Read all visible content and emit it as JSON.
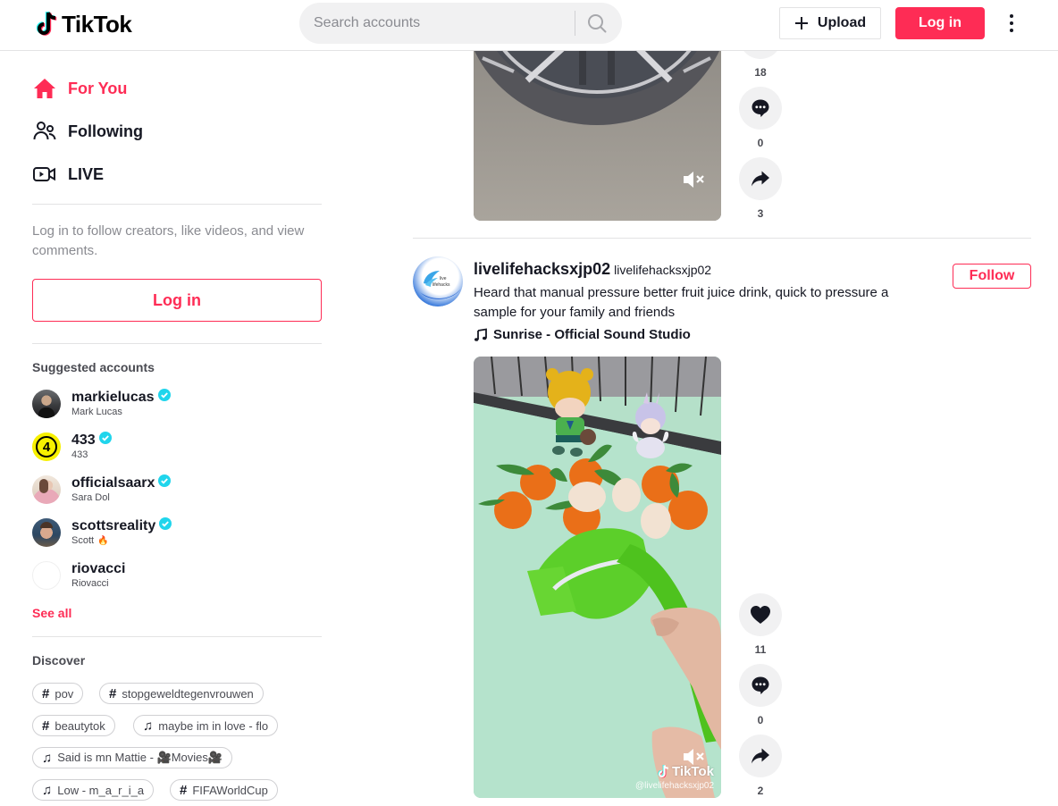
{
  "header": {
    "logo_text": "TikTok",
    "search_placeholder": "Search accounts",
    "upload_label": "Upload",
    "login_label": "Log in"
  },
  "sidebar": {
    "nav": [
      {
        "label": "For You",
        "icon": "home-icon",
        "active": true
      },
      {
        "label": "Following",
        "icon": "people-icon",
        "active": false
      },
      {
        "label": "LIVE",
        "icon": "live-camera-icon",
        "active": false
      }
    ],
    "login_hint": "Log in to follow creators, like videos, and view comments.",
    "login_label": "Log in",
    "suggested_title": "Suggested accounts",
    "accounts": [
      {
        "handle": "markielucas",
        "name": "Mark Lucas",
        "verified": true
      },
      {
        "handle": "433",
        "name": "433",
        "verified": true
      },
      {
        "handle": "officialsaarx",
        "name": "Sara Dol",
        "verified": true
      },
      {
        "handle": "scottsreality",
        "name": "Scott",
        "verified": true,
        "name_emoji": "🔥"
      },
      {
        "handle": "riovacci",
        "name": "Riovacci",
        "verified": false
      }
    ],
    "see_all": "See all",
    "discover_title": "Discover",
    "discover_tags": [
      {
        "type": "hashtag",
        "icon": "#",
        "label": "pov"
      },
      {
        "type": "hashtag",
        "icon": "#",
        "label": "stopgeweldtegenvrouwen"
      },
      {
        "type": "hashtag",
        "icon": "#",
        "label": "beautytok"
      },
      {
        "type": "music",
        "icon": "♫",
        "label": "maybe im in love - flo"
      },
      {
        "type": "music",
        "icon": "♫",
        "label": "Said is mn Mattie - 🎥Movies🎥"
      },
      {
        "type": "music",
        "icon": "♫",
        "label": "Low - m_a_r_i_a"
      },
      {
        "type": "hashtag",
        "icon": "#",
        "label": "FIFAWorldCup"
      }
    ]
  },
  "feed": {
    "previous_post": {
      "likes": "18",
      "comments": "0",
      "shares": "3"
    },
    "post": {
      "handle": "livelifehacksxjp02",
      "nickname": "livelifehacksxjp02",
      "description": "Heard that manual pressure better fruit juice drink, quick to pressure a sample for your family and friends",
      "music": "Sunrise - Official Sound Studio",
      "follow_label": "Follow",
      "likes": "11",
      "comments": "0",
      "shares": "2",
      "watermark_logo": "TikTok",
      "watermark_user": "@livelifehacksxjp02",
      "avatar_text_1": "live",
      "avatar_text_2": "lifehacks"
    }
  },
  "colors": {
    "brand": "#fe2c55",
    "text": "#161823",
    "muted": "#8a8b91",
    "verified": "#20d5ec",
    "action_bg": "#f1f1f2"
  }
}
